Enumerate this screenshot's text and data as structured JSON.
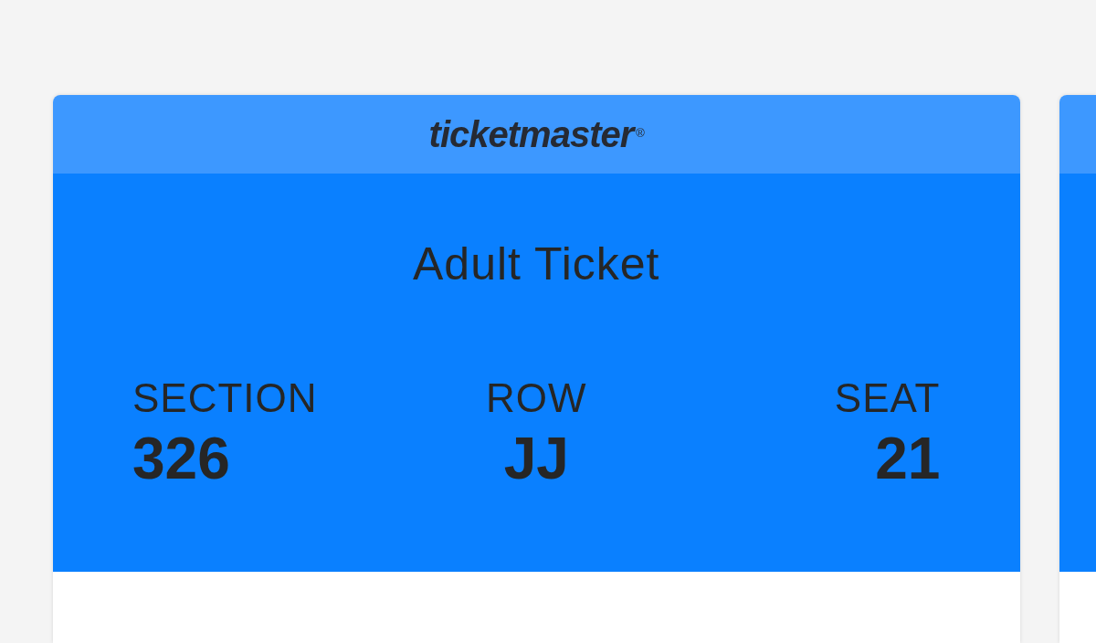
{
  "ticket": {
    "brand": "ticketmaster",
    "brand_mark": "®",
    "title": "Adult Ticket",
    "fields": [
      {
        "label": "SECTION",
        "value": "326"
      },
      {
        "label": "ROW",
        "value": "JJ"
      },
      {
        "label": "SEAT",
        "value": "21"
      }
    ]
  }
}
